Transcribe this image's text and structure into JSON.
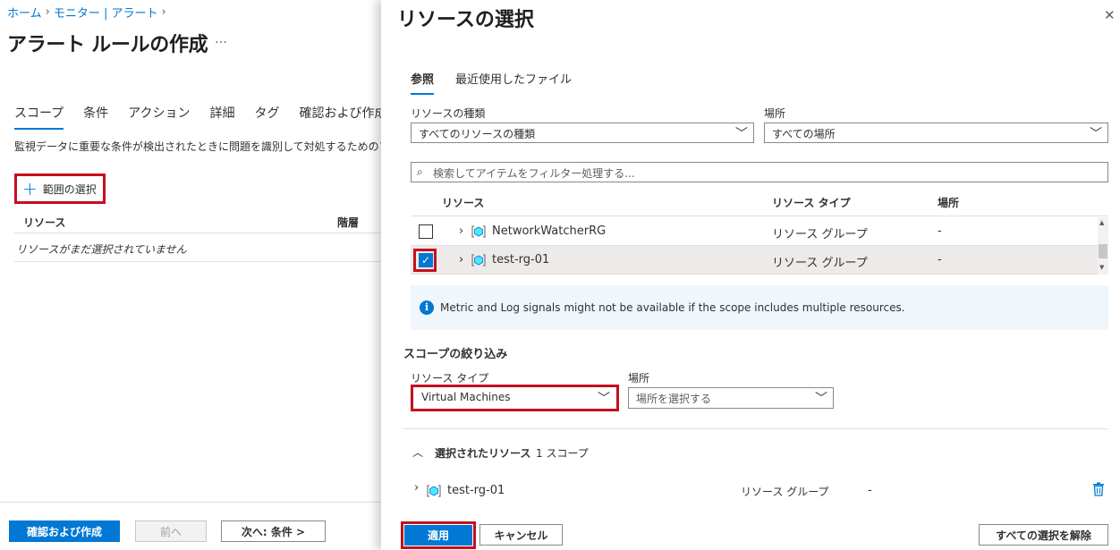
{
  "left_page": {
    "breadcrumb": [
      "ホーム",
      "モニター | アラート"
    ],
    "title": "アラート ルールの作成",
    "more": "…",
    "tabs": [
      "スコープ",
      "条件",
      "アクション",
      "詳細",
      "タグ",
      "確認および作成"
    ],
    "description": "監視データに重要な条件が検出されたときに問題を識別して対処するためのアラー",
    "scope_button": "範囲の選択",
    "table": {
      "columns": [
        "リソース",
        "階層"
      ],
      "empty": "リソースがまだ選択されていません"
    },
    "footer": {
      "review": "確認および作成",
      "prev": "前へ",
      "next": "次へ: 条件 >"
    }
  },
  "blade": {
    "title": "リソースの選択",
    "tabs": [
      "参照",
      "最近使用したファイル"
    ],
    "resource_type": {
      "label": "リソースの種類",
      "value": "すべてのリソースの種類"
    },
    "location": {
      "label": "場所",
      "value": "すべての場所"
    },
    "search_placeholder": "検索してアイテムをフィルター処理する...",
    "grid": {
      "columns": [
        "リソース",
        "リソース タイプ",
        "場所"
      ],
      "rows": [
        {
          "name": "NetworkWatcherRG",
          "type": "リソース グループ",
          "location": "-",
          "checked": false
        },
        {
          "name": "test-rg-01",
          "type": "リソース グループ",
          "location": "-",
          "checked": true
        }
      ]
    },
    "info": "Metric and Log signals might not be available if the scope includes multiple resources.",
    "filter": {
      "title": "スコープの絞り込み",
      "type_label": "リソース タイプ",
      "type_value": "Virtual Machines",
      "location_label": "場所",
      "location_placeholder": "場所を選択する"
    },
    "selected": {
      "title": "選択されたリソース",
      "count": "1 スコープ",
      "row": {
        "name": "test-rg-01",
        "type": "リソース グループ",
        "location": "-"
      }
    },
    "footer": {
      "apply": "適用",
      "cancel": "キャンセル",
      "clear": "すべての選択を解除"
    }
  },
  "colors": {
    "accent": "#0078d4",
    "highlight": "#c50f1f"
  }
}
